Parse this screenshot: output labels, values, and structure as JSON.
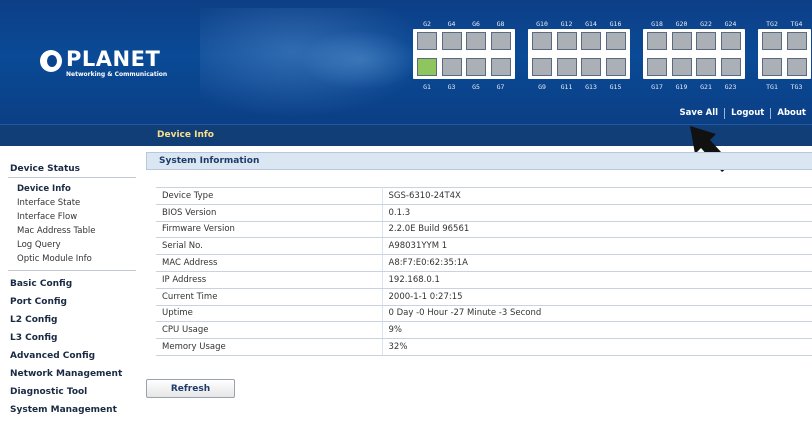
{
  "brand": {
    "name": "PLANET",
    "tagline": "Networking & Communication"
  },
  "ports": {
    "top_row": [
      "G2",
      "G4",
      "G6",
      "G8",
      "G10",
      "G12",
      "G14",
      "G16",
      "G18",
      "G20",
      "G22",
      "G24",
      "TG2",
      "TG4"
    ],
    "bottom_row": [
      "G1",
      "G3",
      "G5",
      "G7",
      "G9",
      "G11",
      "G13",
      "G15",
      "G17",
      "G19",
      "G21",
      "G23",
      "TG1",
      "TG3"
    ],
    "active_port": "G1"
  },
  "header_actions": [
    "Save All",
    "Logout",
    "About"
  ],
  "page_title": "Device Info",
  "sidebar": {
    "device_status": "Device Status",
    "device_status_items": [
      "Device Info",
      "Interface State",
      "Interface Flow",
      "Mac Address Table",
      "Log Query",
      "Optic Module Info"
    ],
    "sections": [
      "Basic Config",
      "Port Config",
      "L2 Config",
      "L3 Config",
      "Advanced Config",
      "Network Management",
      "Diagnostic Tool",
      "System Management"
    ]
  },
  "system_info": {
    "heading": "System Information",
    "rows": [
      {
        "key": "Device Type",
        "value": "SGS-6310-24T4X"
      },
      {
        "key": "BIOS Version",
        "value": "0.1.3"
      },
      {
        "key": "Firmware Version",
        "value": "2.2.0E Build 96561"
      },
      {
        "key": "Serial No.",
        "value": "A98031YYM 1"
      },
      {
        "key": "MAC Address",
        "value": "A8:F7:E0:62:35:1A"
      },
      {
        "key": "IP Address",
        "value": "192.168.0.1"
      },
      {
        "key": "Current Time",
        "value": "2000-1-1 0:27:15"
      },
      {
        "key": "Uptime",
        "value": "0 Day -0 Hour -27 Minute -3 Second"
      },
      {
        "key": "CPU Usage",
        "value": "9%"
      },
      {
        "key": "Memory Usage",
        "value": "32%"
      }
    ]
  },
  "refresh_label": "Refresh",
  "colors": {
    "header_blue": "#0b4590",
    "title_gold": "#f7e08a",
    "port_active": "#8ec55c",
    "port_idle": "#aab0b6"
  }
}
